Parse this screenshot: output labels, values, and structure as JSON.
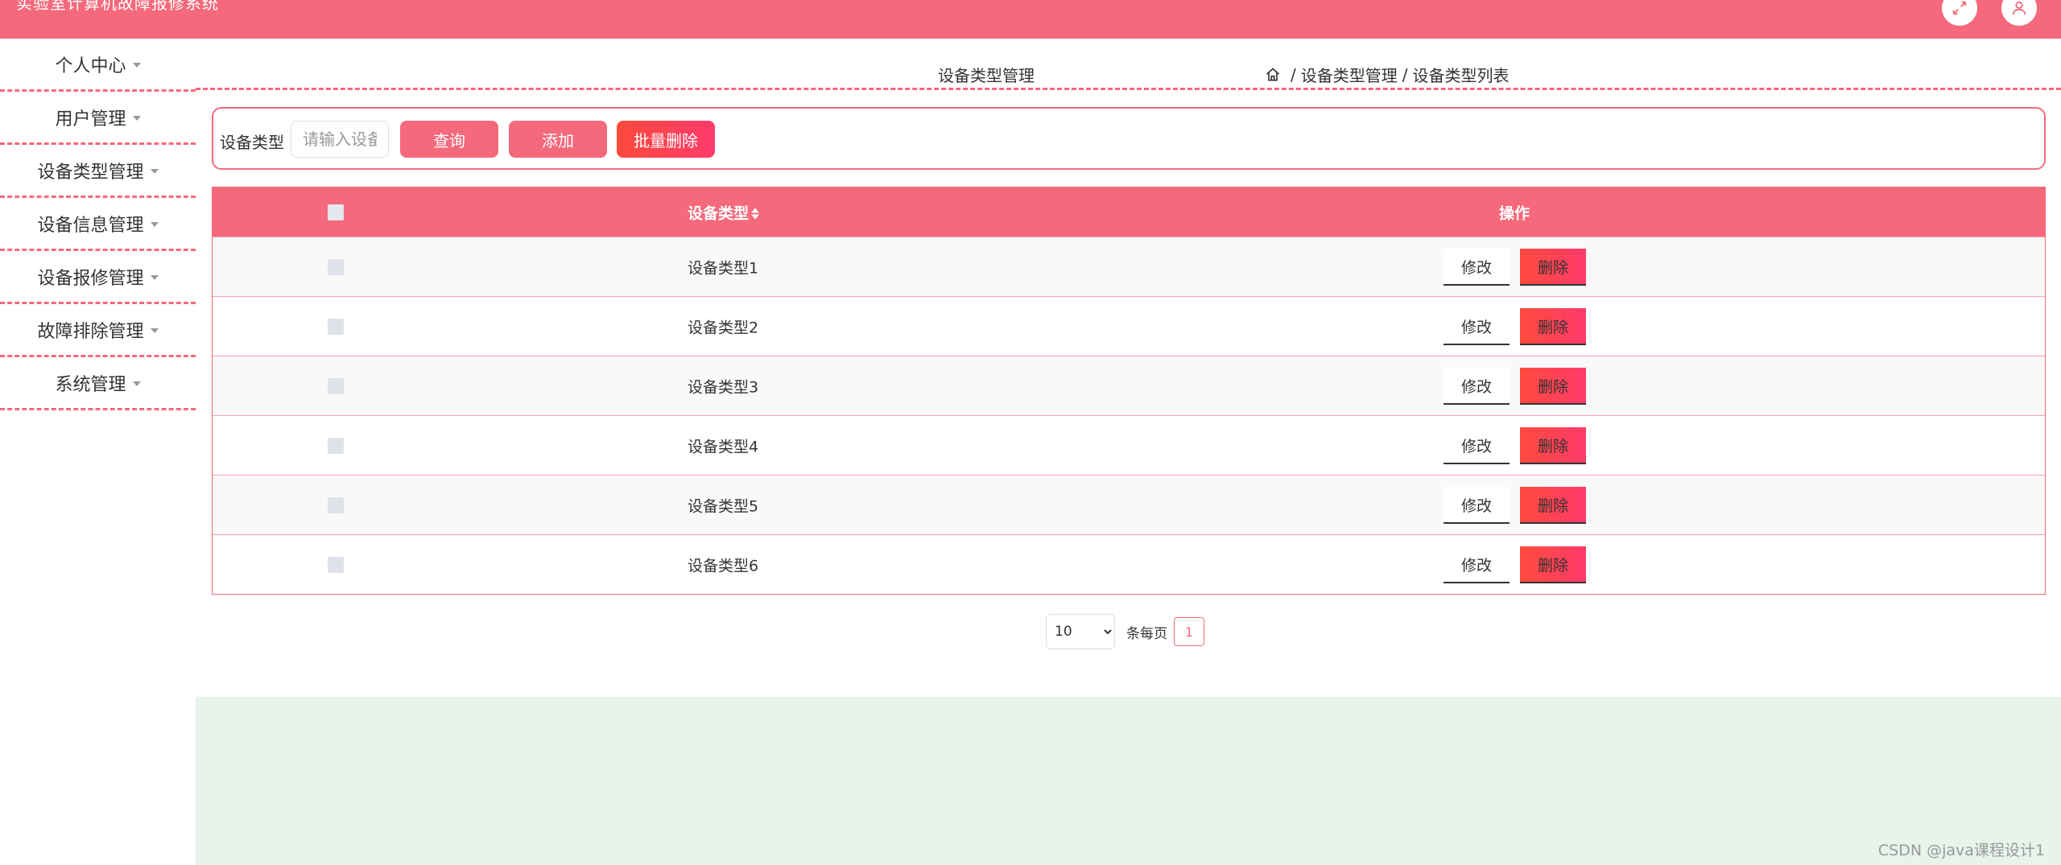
{
  "header": {
    "app_title": "实验室计算机故障报修系统",
    "background_color": "#f4697b",
    "fullscreen_icon": "expand-arrows-icon",
    "user_icon": "user-icon"
  },
  "sidebar": {
    "items": [
      {
        "label": "个人中心"
      },
      {
        "label": "用户管理"
      },
      {
        "label": "设备类型管理"
      },
      {
        "label": "设备信息管理"
      },
      {
        "label": "设备报修管理"
      },
      {
        "label": "故障排除管理"
      },
      {
        "label": "系统管理"
      }
    ]
  },
  "breadcrumb": {
    "title": "设备类型管理",
    "home_icon": "home-icon",
    "separator": "/",
    "level1": "设备类型管理",
    "level2": "设备类型列表"
  },
  "search": {
    "label": "设备类型",
    "placeholder": "请输入设备类型",
    "query_label": "查询",
    "add_label": "添加",
    "batch_delete_label": "批量删除"
  },
  "table": {
    "columns": {
      "type": "设备类型",
      "operation": "操作"
    },
    "rows": [
      {
        "type": "设备类型1"
      },
      {
        "type": "设备类型2"
      },
      {
        "type": "设备类型3"
      },
      {
        "type": "设备类型4"
      },
      {
        "type": "设备类型5"
      },
      {
        "type": "设备类型6"
      }
    ],
    "edit_label": "修改",
    "delete_label": "删除"
  },
  "pagination": {
    "page_size": "10",
    "page_size_label": "条每页",
    "current_page": "1"
  },
  "watermark": "CSDN @java课程设计1",
  "colors": {
    "accent": "#f4697b",
    "danger": "#ff4a3d",
    "footer_bg": "#e6f4ec"
  }
}
